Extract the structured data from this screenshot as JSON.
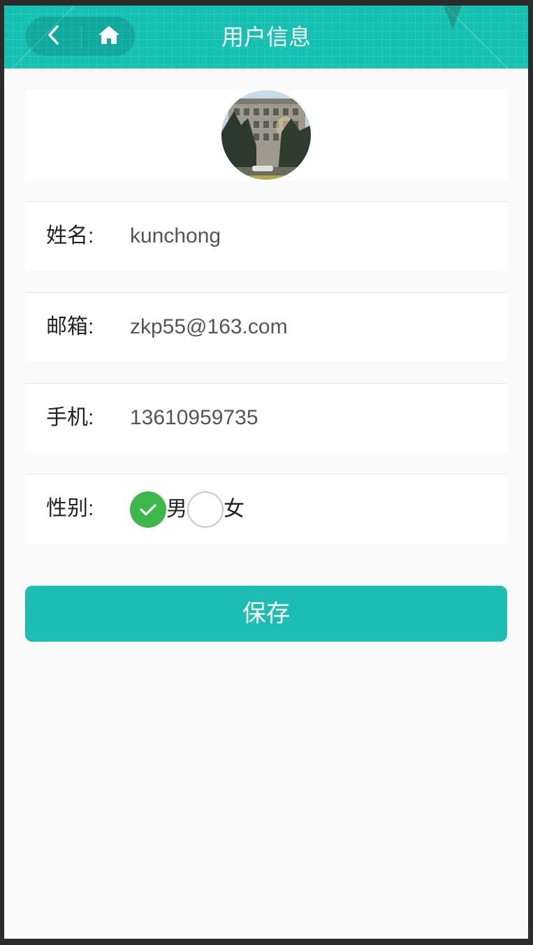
{
  "header": {
    "title": "用户信息",
    "back_icon": "chevron-left-icon",
    "home_icon": "home-icon",
    "background_color": "#13c0b2"
  },
  "profile": {
    "avatar_alt": "avatar"
  },
  "form": {
    "name": {
      "label": "姓名:",
      "value": "kunchong"
    },
    "email": {
      "label": "邮箱:",
      "value": "zkp55@163.com"
    },
    "phone": {
      "label": "手机:",
      "value": "13610959735"
    },
    "gender": {
      "label": "性别:",
      "options": [
        {
          "label": "男",
          "checked": true
        },
        {
          "label": "女",
          "checked": false
        }
      ]
    }
  },
  "save_button": {
    "label": "保存",
    "color": "#1cbdb3"
  },
  "colors": {
    "check_green": "#3cb84a",
    "page_background": "#fafafa"
  }
}
